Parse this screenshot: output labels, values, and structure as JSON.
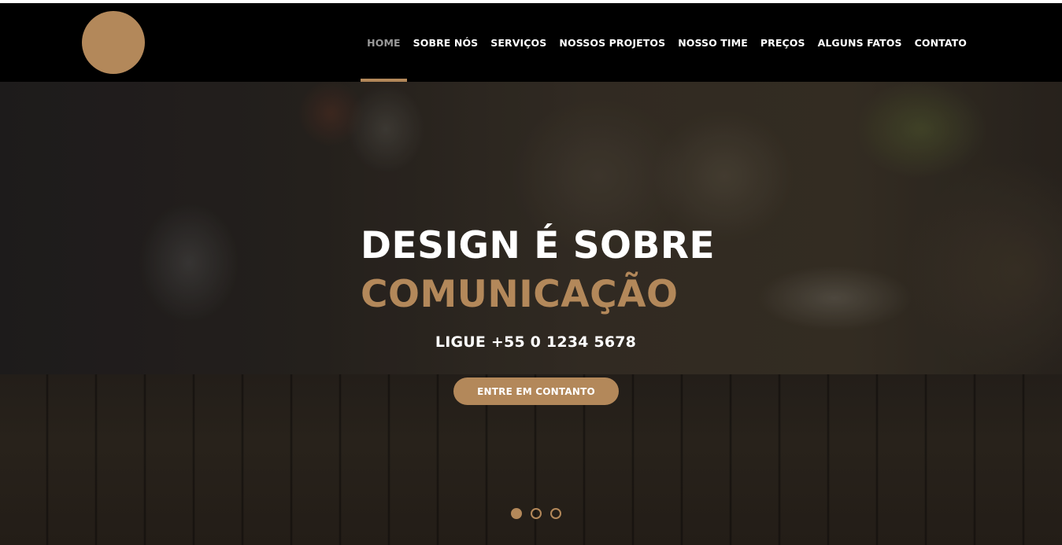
{
  "colors": {
    "accent": "#b3885a",
    "navbar_bg": "#000000",
    "nav_text": "#ffffff",
    "nav_active_text": "#9a9a9a"
  },
  "header": {
    "logo_icon": "circle-logo"
  },
  "nav": {
    "items": [
      {
        "label": "HOME",
        "active": true
      },
      {
        "label": "SOBRE NÓS",
        "active": false
      },
      {
        "label": "SERVIÇOS",
        "active": false
      },
      {
        "label": "NOSSOS PROJETOS",
        "active": false
      },
      {
        "label": "NOSSO TIME",
        "active": false
      },
      {
        "label": "PREÇOS",
        "active": false
      },
      {
        "label": "ALGUNS FATOS",
        "active": false
      },
      {
        "label": "CONTATO",
        "active": false
      }
    ]
  },
  "hero": {
    "headline_line1": "DESIGN É SOBRE",
    "headline_line2": "COMUNICAÇÃO",
    "phone": "LIGUE +55 0 1234 5678",
    "cta_label": "ENTRE EM CONTANTO",
    "slider": {
      "total": 3,
      "active_index": 0
    }
  }
}
